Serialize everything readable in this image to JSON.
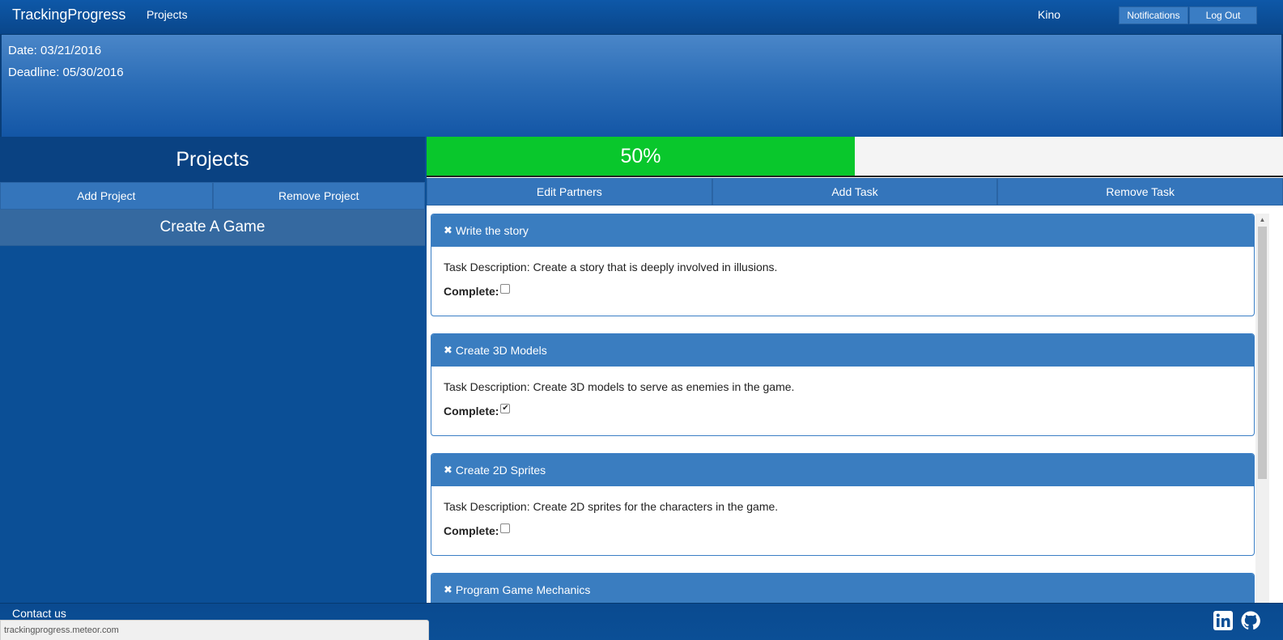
{
  "navbar": {
    "brand": "TrackingProgress",
    "projects_link": "Projects",
    "user": "Kino",
    "notifications_label": "Notifications",
    "logout_label": "Log Out"
  },
  "header": {
    "date": "Date: 03/21/2016",
    "deadline": "Deadline: 05/30/2016"
  },
  "sidebar": {
    "title": "Projects",
    "add_project_label": "Add Project",
    "remove_project_label": "Remove Project",
    "projects": [
      {
        "name": "Create A Game"
      }
    ]
  },
  "progress": {
    "label": "50%",
    "fraction": 0.5,
    "fill_color": "#09c72c"
  },
  "task_actions": {
    "edit_partners_label": "Edit Partners",
    "add_task_label": "Add Task",
    "remove_task_label": "Remove Task"
  },
  "complete_label": "Complete:",
  "tasks": [
    {
      "title": "Write the story",
      "description": "Task Description: Create a story that is deeply involved in illusions.",
      "complete": false
    },
    {
      "title": "Create 3D Models",
      "description": "Task Description: Create 3D models to serve as enemies in the game.",
      "complete": true
    },
    {
      "title": "Create 2D Sprites",
      "description": "Task Description: Create 2D sprites for the characters in the game.",
      "complete": false
    },
    {
      "title": "Program Game Mechanics",
      "description": "",
      "complete": false
    }
  ],
  "footer": {
    "contact_label": "Contact us",
    "status_url": "trackingprogress.meteor.com",
    "social_icons": [
      "linkedin-icon",
      "github-icon"
    ]
  },
  "colors": {
    "primary_blue": "#0b4f96",
    "button_blue": "#3475bb",
    "progress_green": "#09c72c"
  }
}
